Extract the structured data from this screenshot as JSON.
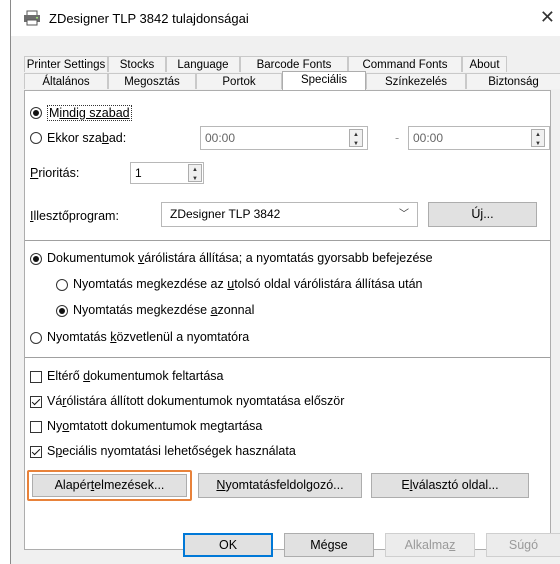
{
  "window": {
    "title": "ZDesigner TLP 3842 tulajdonságai"
  },
  "tabs_row1": [
    "Printer Settings",
    "Stocks",
    "Language",
    "Barcode Fonts",
    "Command Fonts",
    "About"
  ],
  "tabs_row2": [
    "Általános",
    "Megosztás",
    "Portok",
    "Speciális",
    "Színkezelés",
    "Biztonság"
  ],
  "active_tab": "Speciális",
  "availability": {
    "always_label_pre": "M",
    "always_label_ul": "indig szabad",
    "always_label_post": "",
    "from_label_pre": "Ekkor sza",
    "from_label_ul": "b",
    "from_label_post": "ad:",
    "from_value": "00:00",
    "dash": "-",
    "to_value": "00:00"
  },
  "priority": {
    "label_ul": "P",
    "label_post": "rioritás:",
    "value": "1"
  },
  "driver": {
    "label_ul": "I",
    "label_post": "llesztőprogram:",
    "value": "ZDesigner TLP 3842",
    "new_button_pre": "Ú",
    "new_button_ul": "j",
    "new_button_post": "..."
  },
  "spool": {
    "spool_label_pre": "Dokumentumok ",
    "spool_label_ul": "v",
    "spool_label_post": "árólistára állítása; a nyomtatás gyorsabb befejezése",
    "after_last_pre": "Nyomtatás megkezdése az ",
    "after_last_ul": "u",
    "after_last_post": "tolsó oldal várólistára állítása után",
    "immediately_pre": "Nyomtatás megkezdése ",
    "immediately_ul": "a",
    "immediately_post": "zonnal",
    "direct_pre": "Nyomtatás ",
    "direct_ul": "k",
    "direct_post": "özvetlenül a nyomtatóra"
  },
  "options": {
    "hold_pre": "Eltérő ",
    "hold_ul": "d",
    "hold_post": "okumentumok feltartása",
    "first_pre": "Vá",
    "first_ul": "r",
    "first_post": "ólistára állított dokumentumok nyomtatása először",
    "keep_pre": "Ny",
    "keep_ul": "o",
    "keep_post": "mtatott dokumentumok megtartása",
    "advanced_pre": "S",
    "advanced_ul": "p",
    "advanced_post": "eciális nyomtatási lehetőségek használata"
  },
  "buttons": {
    "defaults_pre": "Alapér",
    "defaults_ul": "t",
    "defaults_post": "elmezések...",
    "processor_pre": "",
    "processor_ul": "N",
    "processor_post": "yomtatásfeldolgozó...",
    "separator_pre": "E",
    "separator_ul": "l",
    "separator_post": "választó oldal...",
    "ok": "OK",
    "cancel": "Mégse",
    "apply_pre": "Alkalma",
    "apply_ul": "z",
    "help": "Súgó"
  },
  "state": {
    "always_available": true,
    "from_available": false,
    "spool": true,
    "after_last": false,
    "immediately": true,
    "direct": false,
    "hold": false,
    "first": true,
    "keep": false,
    "advanced": true
  },
  "colors": {
    "focus_orange": "#e8823a",
    "primary_blue": "#0078d7"
  }
}
